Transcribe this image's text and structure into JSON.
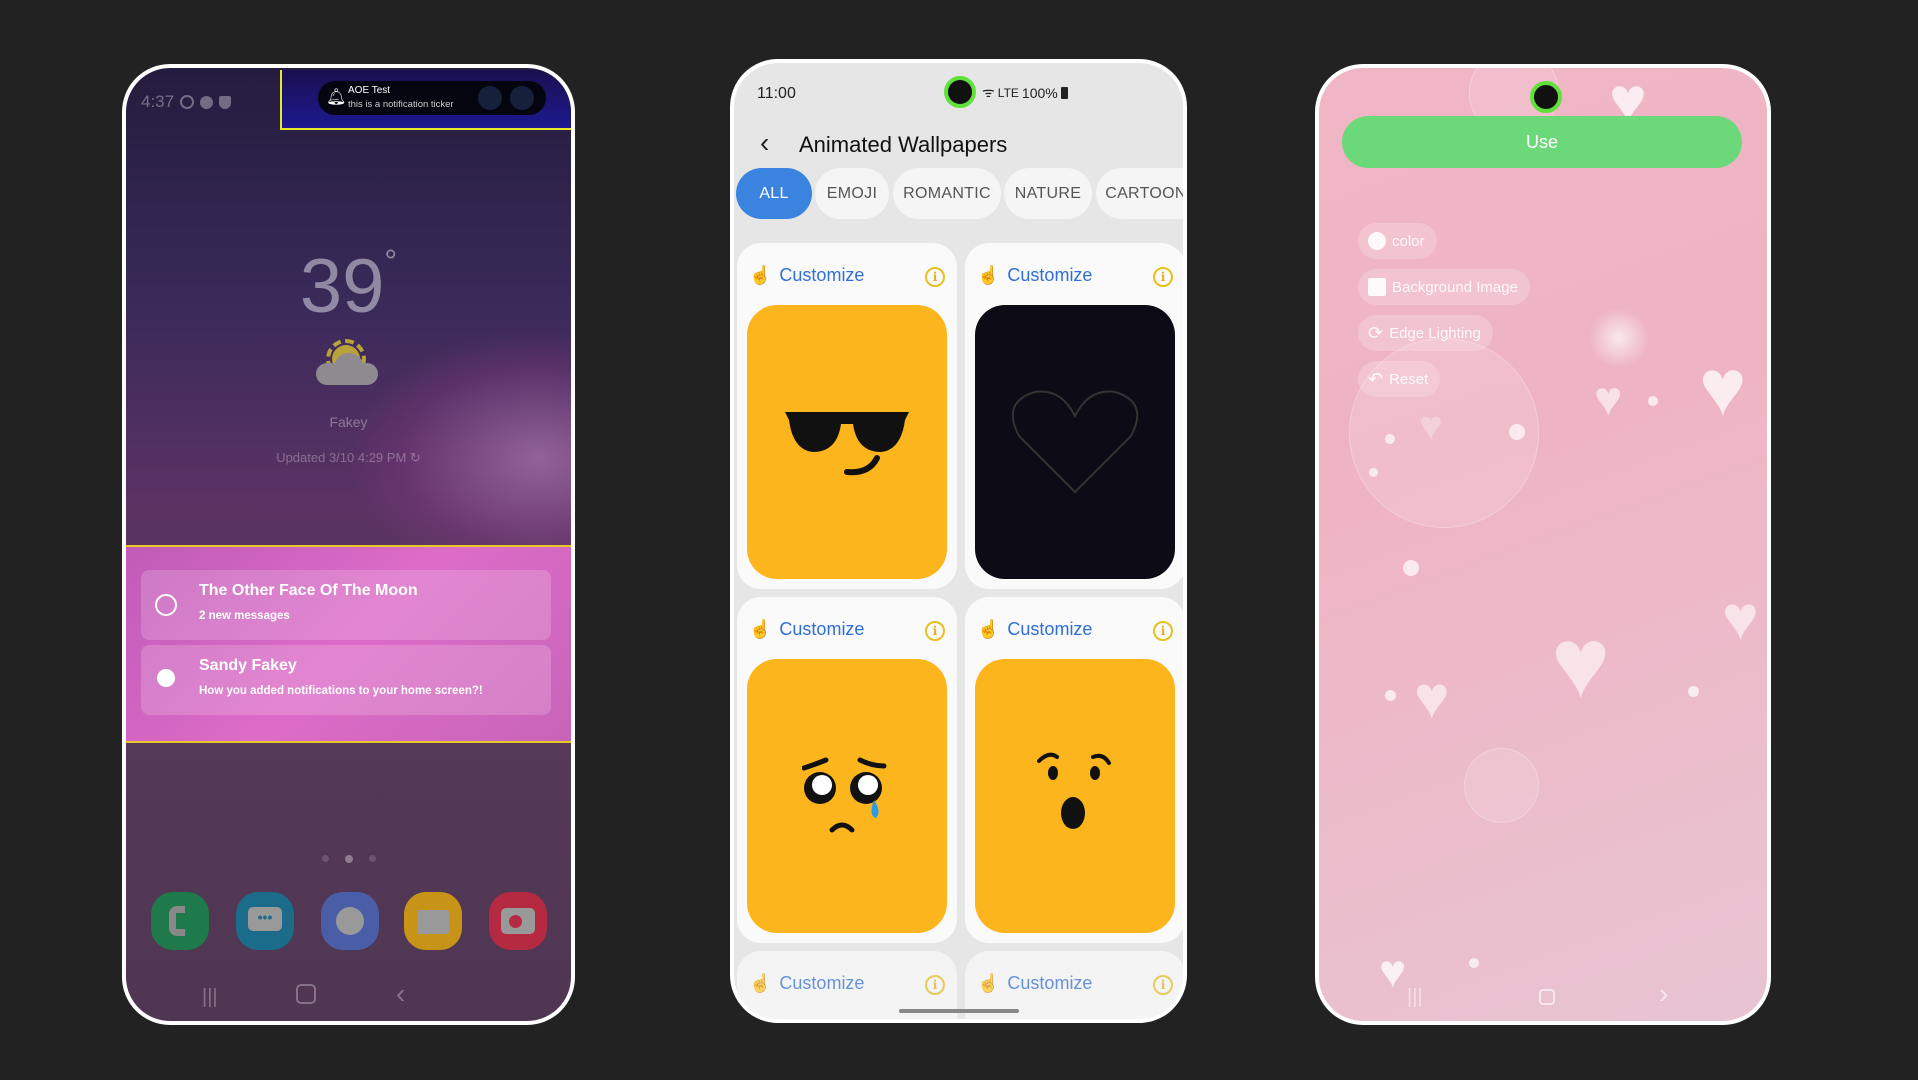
{
  "lockscreen": {
    "status_time": "4:37",
    "ticker": {
      "title": "AOE Test",
      "text": "this is a notification ticker"
    },
    "weather": {
      "temperature": "39",
      "degree": "°",
      "location": "Fakey",
      "updated": "Updated 3/10 4:29 PM"
    },
    "notifications": [
      {
        "app_icon": "whatsapp-icon",
        "title": "The Other Face Of The Moon",
        "text": "2 new messages"
      },
      {
        "app_icon": "messenger-icon",
        "title": "Sandy Fakey",
        "text": "How you added notifications to your home screen?!"
      }
    ],
    "dock": [
      {
        "name": "phone",
        "color": "#1e7a4a"
      },
      {
        "name": "messages",
        "color": "#1b6c8a"
      },
      {
        "name": "internet",
        "color": "#4a5ea8"
      },
      {
        "name": "files",
        "color": "#c79418"
      },
      {
        "name": "camera",
        "color": "#b52a40"
      }
    ],
    "nav": {
      "recents": "|||",
      "home": "○",
      "back": "‹"
    }
  },
  "gallery": {
    "status": {
      "time": "11:00",
      "network": "LTE",
      "battery": "100%"
    },
    "title": "Animated Wallpapers",
    "tabs": [
      {
        "label": "ALL",
        "active": true
      },
      {
        "label": "EMOJI"
      },
      {
        "label": "ROMANTIC"
      },
      {
        "label": "NATURE"
      },
      {
        "label": "CARTOON"
      }
    ],
    "cards": [
      {
        "label": "Customize",
        "image": "cool-sunglasses-emoji"
      },
      {
        "label": "Customize",
        "image": "heart-outline-dark"
      },
      {
        "label": "Customize",
        "image": "pleading-crying-emoji"
      },
      {
        "label": "Customize",
        "image": "surprised-emoji"
      },
      {
        "label": "Customize"
      },
      {
        "label": "Customize"
      }
    ],
    "accent": "#3a84e0"
  },
  "preview": {
    "use_label": "Use",
    "use_color": "#6bd87a",
    "options": [
      {
        "label": "color",
        "icon": "palette-icon"
      },
      {
        "label": "Background Image",
        "icon": "image-icon"
      },
      {
        "label": "Edge Lighting",
        "icon": "sync-icon"
      },
      {
        "label": "Reset",
        "icon": "undo-icon"
      }
    ],
    "nav": {
      "recents": "|||",
      "home": "○",
      "back": "›"
    }
  }
}
